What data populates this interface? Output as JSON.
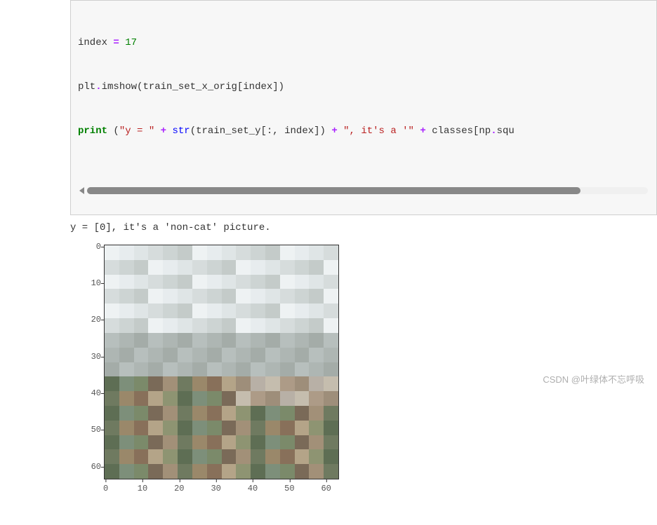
{
  "code": {
    "line1": {
      "var": "index ",
      "op": "=",
      "val": " 17"
    },
    "line2": {
      "p1": "plt",
      "dot1": ".",
      "fn": "imshow",
      "p2": "(train_set_x_orig[index])"
    },
    "line3": {
      "kw": "print",
      "sp": " ",
      "open": "(",
      "s1": "\"y = \"",
      "plus1": " + ",
      "fn1": "str",
      "arg1": "(train_set_y[:, index])",
      "plus2": " + ",
      "s2": "\", it's a '\"",
      "plus3": " + ",
      "p3": "classes[np",
      "dot2": ".",
      "p4": "squ"
    }
  },
  "output_text": "y = [0], it's a 'non-cat' picture.",
  "watermark": "CSDN @叶绿体不忘呼吸",
  "chart_data": {
    "type": "heatmap",
    "title": "",
    "xlabel": "",
    "ylabel": "",
    "x_ticks": [
      0,
      10,
      20,
      30,
      40,
      50,
      60
    ],
    "y_ticks": [
      0,
      10,
      20,
      30,
      40,
      50,
      60
    ],
    "xlim": [
      -0.5,
      63.5
    ],
    "ylim": [
      63.5,
      -0.5
    ],
    "description": "64x64 RGB image displayed via plt.imshow; content depicts an overcast sky over a blurry townscape with buildings and greenery (pixelated, low resolution). Not a cat.",
    "image_shape": [
      64,
      64,
      3
    ]
  }
}
